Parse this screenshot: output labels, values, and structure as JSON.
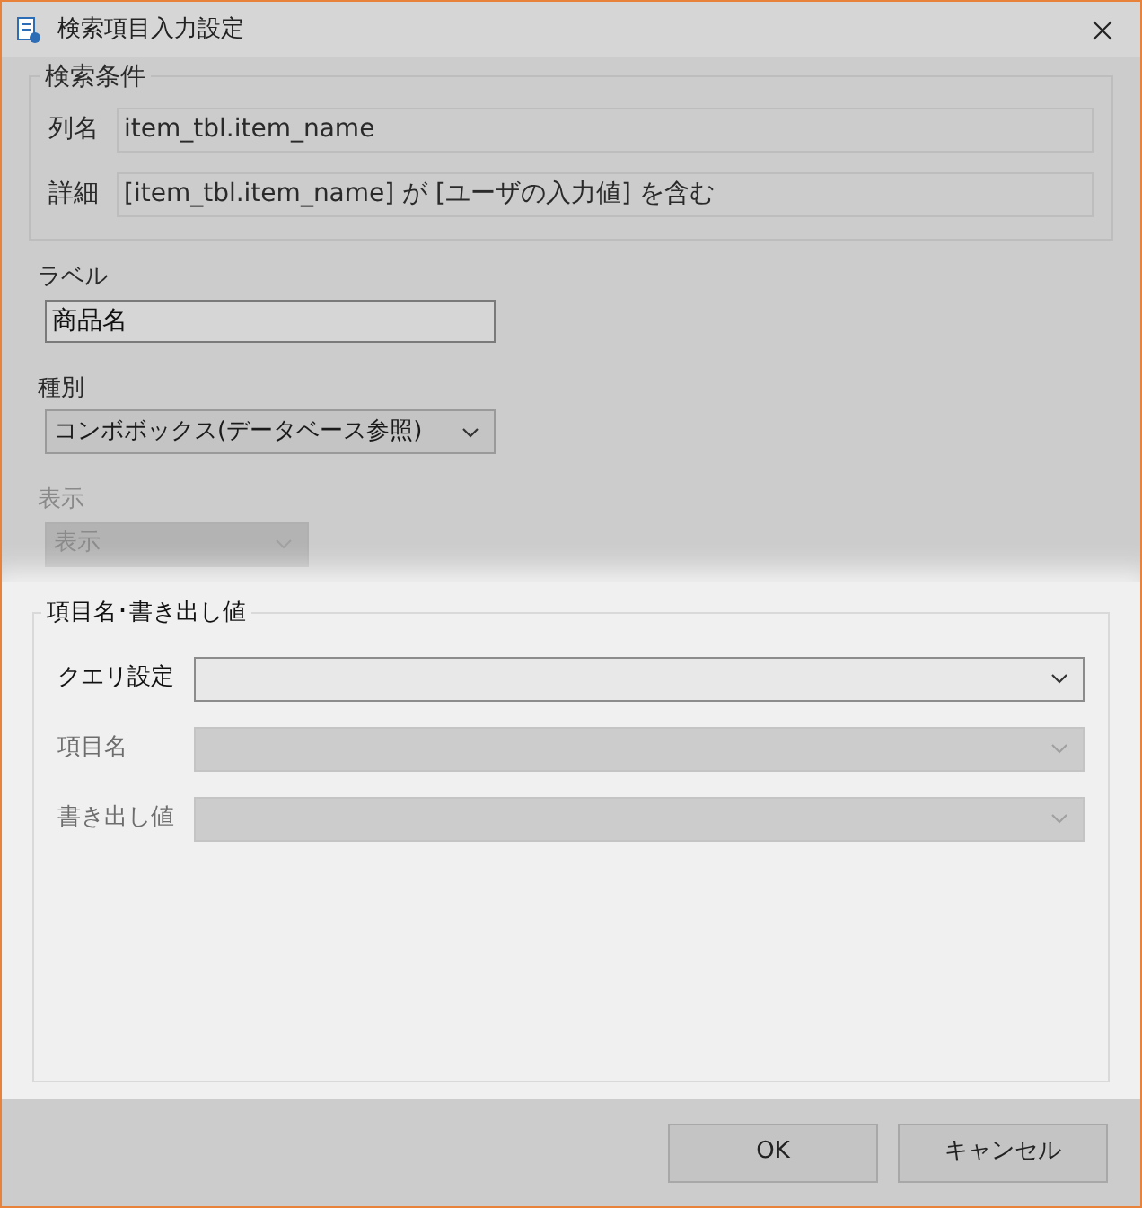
{
  "window": {
    "title": "検索項目入力設定"
  },
  "search_conditions": {
    "legend": "検索条件",
    "rows": [
      {
        "label": "列名",
        "value": "item_tbl.item_name"
      },
      {
        "label": "詳細",
        "value": "[item_tbl.item_name] が [ユーザの入力値] を含む"
      }
    ]
  },
  "label_field": {
    "label": "ラベル",
    "value": "商品名"
  },
  "type_field": {
    "label": "種別",
    "value": "コンボボックス(データベース参照)",
    "disabled": false
  },
  "display_field": {
    "label": "表示",
    "value": "表示",
    "disabled": true
  },
  "item_group": {
    "legend": "項目名･書き出し値",
    "rows": [
      {
        "label": "クエリ設定",
        "disabled": false
      },
      {
        "label": "項目名",
        "disabled": true
      },
      {
        "label": "書き出し値",
        "disabled": true
      }
    ]
  },
  "buttons": [
    "OK",
    "キャンセル"
  ]
}
